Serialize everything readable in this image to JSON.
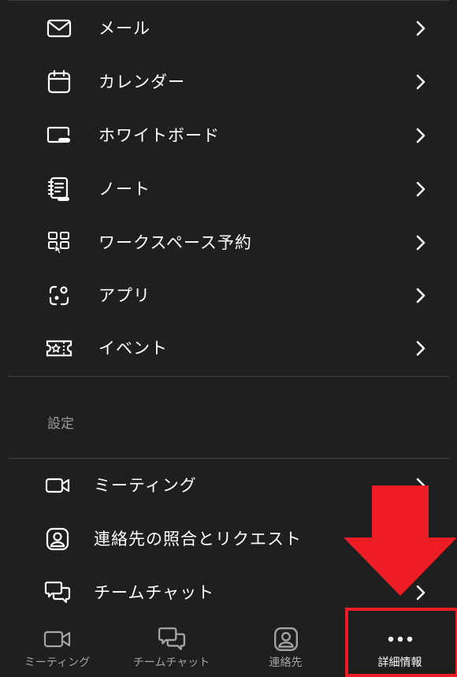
{
  "menu_items": [
    {
      "label": "メール",
      "icon": "mail-icon"
    },
    {
      "label": "カレンダー",
      "icon": "calendar-icon"
    },
    {
      "label": "ホワイトボード",
      "icon": "whiteboard-icon"
    },
    {
      "label": "ノート",
      "icon": "notes-icon"
    },
    {
      "label": "ワークスペース予約",
      "icon": "workspace-reservation-icon"
    },
    {
      "label": "アプリ",
      "icon": "apps-icon"
    },
    {
      "label": "イベント",
      "icon": "events-icon"
    }
  ],
  "settings": {
    "header": "設定",
    "items": [
      {
        "label": "ミーティング",
        "icon": "video-camera-icon"
      },
      {
        "label": "連絡先の照合とリクエスト",
        "icon": "contact-icon"
      },
      {
        "label": "チームチャット",
        "icon": "chat-icon"
      }
    ]
  },
  "tabbar": {
    "tabs": [
      {
        "label": "ミーティング",
        "icon": "video-camera-icon"
      },
      {
        "label": "チームチャット",
        "icon": "chat-icon"
      },
      {
        "label": "連絡先",
        "icon": "contact-icon"
      },
      {
        "label": "詳細情報",
        "icon": "more-icon",
        "active": true
      }
    ]
  },
  "colors": {
    "background": "#1f1f1f",
    "text": "#ffffff",
    "muted": "#a5a5a5",
    "annotation": "#ee1c24"
  }
}
